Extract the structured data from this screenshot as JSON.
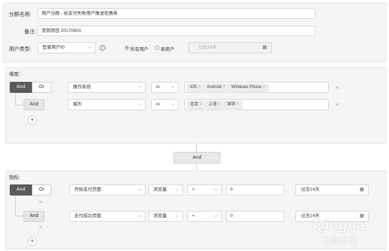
{
  "top": {
    "name_label": "分群名称:",
    "name_value": "用户分群 - 给支付失败用户推送优惠券",
    "note_label": "备注:",
    "note_value": "营销项目 20170803",
    "user_type_label": "用户类型:",
    "user_type_value": "登录用户ID",
    "radio_all": "所有用户",
    "radio_new": "新用户",
    "date_placeholder": "过去14天"
  },
  "dimension": {
    "section_label": "维度:",
    "and_label": "And",
    "or_label": "Or",
    "rows": [
      {
        "field": "操作系统",
        "op": "in",
        "tags": [
          "iOS",
          "Android",
          "Windows Phone"
        ],
        "sub_and": ""
      },
      {
        "field": "城市",
        "op": "in",
        "tags": [
          "北京",
          "上海",
          "深圳"
        ],
        "sub_and": "And"
      }
    ]
  },
  "connector": {
    "label": "And"
  },
  "metric": {
    "section_label": "指标:",
    "and_label": "And",
    "or_label": "Or",
    "rows": [
      {
        "event": "开始支付页面",
        "measure": "浏览量",
        "op": ">",
        "value": "0",
        "date": "过去14天",
        "sub_and": ""
      },
      {
        "event": "支付成功页面",
        "measure": "浏览量",
        "op": "=",
        "value": "0",
        "date": "过去14天",
        "sub_and": "And"
      }
    ]
  },
  "icons": {
    "chevron": "⌵",
    "close": "×",
    "plus": "+",
    "calendar": "▦",
    "info": "i"
  },
  "watermark": {
    "brand": "Qingua",
    "sub": "青瓜传媒"
  }
}
